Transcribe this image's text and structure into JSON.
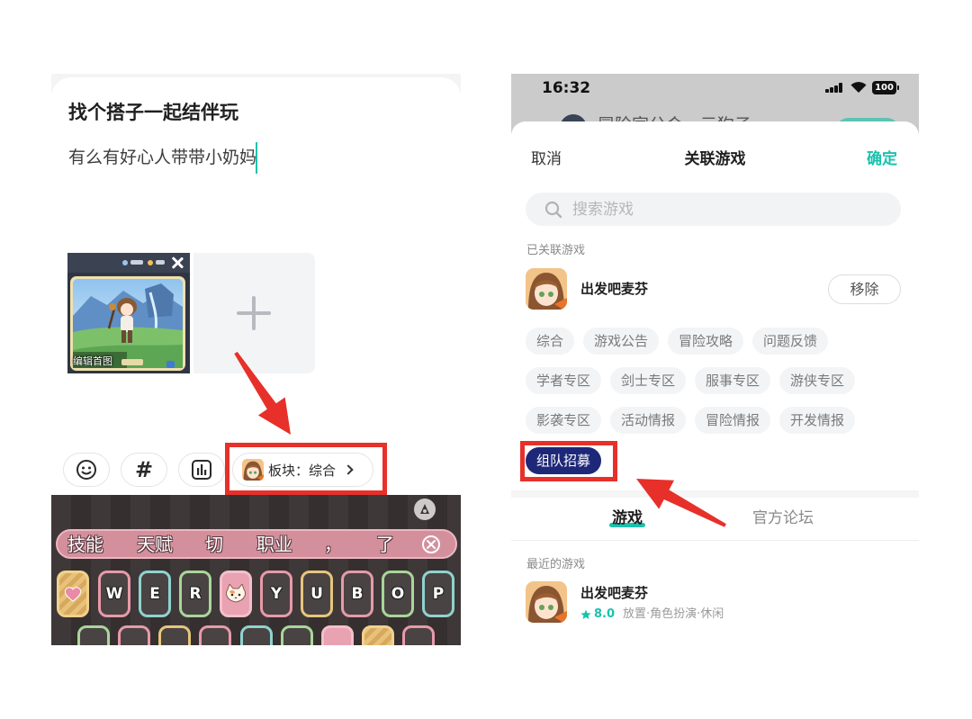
{
  "left": {
    "title": "找个搭子一起结伴玩",
    "body": "有么有好心人带带小奶妈",
    "cover": {
      "edit_label": "编辑首图",
      "close_icon": "close-icon"
    },
    "add_tile_icon": "plus-icon",
    "toolbar": {
      "emoji_icon": "emoji-icon",
      "hashtag": "#",
      "poll_icon": "poll-chart-icon",
      "section_icon": "game-icon",
      "section_label": "板块：综合",
      "chevron_icon": "chevron-right-icon"
    },
    "keyboard": {
      "theme_icon": "keyboard-theme-icon",
      "suggestions": [
        "技能",
        "天赋",
        "切",
        "职业",
        "，",
        "了"
      ],
      "clear_icon": "clear-suggestions-icon",
      "special_key_icons": [
        "heart-icon",
        "cat-icon"
      ],
      "row1_letters": [
        "W",
        "E",
        "R",
        "Y",
        "U",
        "B",
        "O",
        "P"
      ]
    }
  },
  "right": {
    "status_bar": {
      "time": "16:32",
      "battery": "100",
      "icons": [
        "signal-icon",
        "wifi-icon",
        "battery-icon"
      ]
    },
    "background_post": {
      "title": "冒险家公会 - 元狗子"
    },
    "header": {
      "cancel": "取消",
      "title": "关联游戏",
      "confirm": "确定"
    },
    "search": {
      "icon": "search-icon",
      "placeholder": "搜索游戏"
    },
    "linked": {
      "section_label": "已关联游戏",
      "game_name": "出发吧麦芬",
      "remove_label": "移除"
    },
    "tag_rows": [
      [
        "综合",
        "游戏公告",
        "冒险攻略",
        "问题反馈"
      ],
      [
        "学者专区",
        "剑士专区",
        "服事专区",
        "游侠专区"
      ],
      [
        "影袭专区",
        "活动情报",
        "冒险情报",
        "开发情报"
      ],
      [
        "组队招募"
      ]
    ],
    "selected_tag": "组队招募",
    "tabs": [
      {
        "label": "游戏",
        "active": true
      },
      {
        "label": "官方论坛",
        "active": false
      }
    ],
    "recent": {
      "section_label": "最近的游戏",
      "game_name": "出发吧麦芬",
      "rating": "8.0",
      "genres": "放置·角色扮演·休闲"
    }
  },
  "colors": {
    "accent_teal": "#19c2ae",
    "selected_tag_bg": "#1e2878",
    "annotation_red": "#e7302a",
    "chip_bg": "#f3f4f6",
    "suggestion_bar": "#d3909c"
  }
}
